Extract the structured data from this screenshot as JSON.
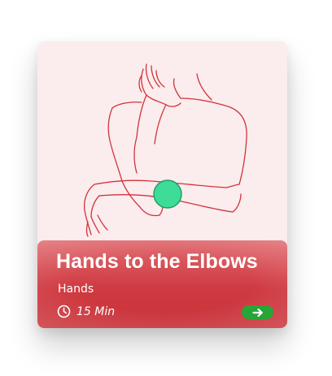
{
  "exercise_card": {
    "title": "Hands to the Elbows",
    "category": "Hands",
    "duration": "15 Min",
    "illustration_icon": "arms-crossed-illustration",
    "duration_icon": "clock-icon",
    "go_icon": "arrow-right-icon",
    "colors": {
      "card_background": "#fbecee",
      "info_panel": "#d2444a",
      "line_art": "#d0343a",
      "highlight_marker": "#3ddc97",
      "go_button": "#27a535",
      "text": "#ffffff"
    }
  }
}
